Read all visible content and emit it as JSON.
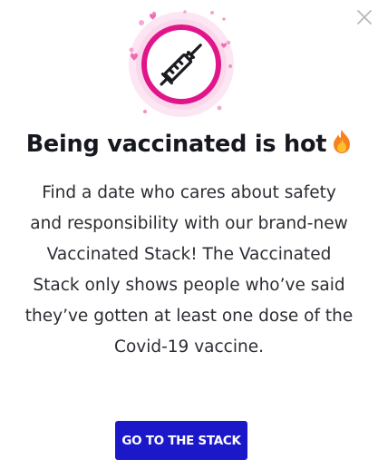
{
  "modal": {
    "title": "Being vaccinated is hot",
    "title_icon": "fire-emoji",
    "hero_icon": "syringe-icon",
    "close_icon": "close-icon",
    "body_lines": [
      "Find a date who cares about safety",
      "and responsibility with our brand-new",
      "Vaccinated Stack! The Vaccinated",
      "Stack only shows people who’ve said",
      "they’ve gotten at least one dose of the",
      "Covid-19 vaccine."
    ],
    "cta_label": "GO TO THE STACK"
  },
  "colors": {
    "accent_pink": "#e0158a",
    "badge_bg": "#fbd7ec",
    "cta_bg": "#1b18c9",
    "title": "#16181f"
  }
}
